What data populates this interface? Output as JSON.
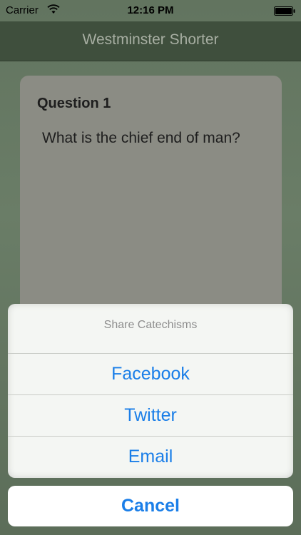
{
  "status_bar": {
    "carrier": "Carrier",
    "time": "12:16 PM"
  },
  "nav": {
    "title": "Westminster Shorter"
  },
  "card": {
    "question_number": "Question 1",
    "question_text": "What is the chief end of man?"
  },
  "action_sheet": {
    "title": "Share Catechisms",
    "options": [
      {
        "label": "Facebook"
      },
      {
        "label": "Twitter"
      },
      {
        "label": "Email"
      }
    ],
    "cancel_label": "Cancel"
  },
  "colors": {
    "accent": "#1a7ee8",
    "nav_background": "#3f4f3d",
    "card_background": "#8b8c84"
  },
  "icons": {
    "wifi": "wifi-icon",
    "battery": "battery-icon"
  }
}
